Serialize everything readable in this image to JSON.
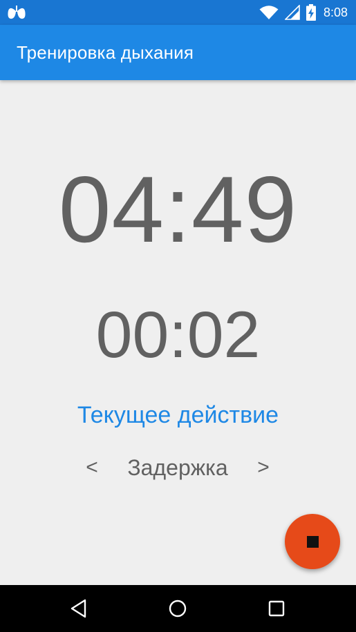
{
  "status_bar": {
    "time": "8:08",
    "icons": [
      "lungs-icon",
      "wifi-icon",
      "signal-icon",
      "battery-charging-icon"
    ]
  },
  "app_bar": {
    "title": "Тренировка дыхания"
  },
  "timer": {
    "total": "04:49",
    "phase": "00:02"
  },
  "current_action": {
    "label": "Текущее действие",
    "name": "Задержка",
    "prev_label": "<",
    "next_label": ">"
  },
  "fab": {
    "icon": "stop-icon",
    "color": "#e64a19"
  },
  "nav_bar": {
    "buttons": [
      "back-icon",
      "home-icon",
      "recents-icon"
    ]
  },
  "colors": {
    "status_bar": "#1976d2",
    "app_bar": "#1e88e5",
    "background": "#efefef",
    "timer_text": "#616161",
    "accent_text": "#1e88e5"
  }
}
